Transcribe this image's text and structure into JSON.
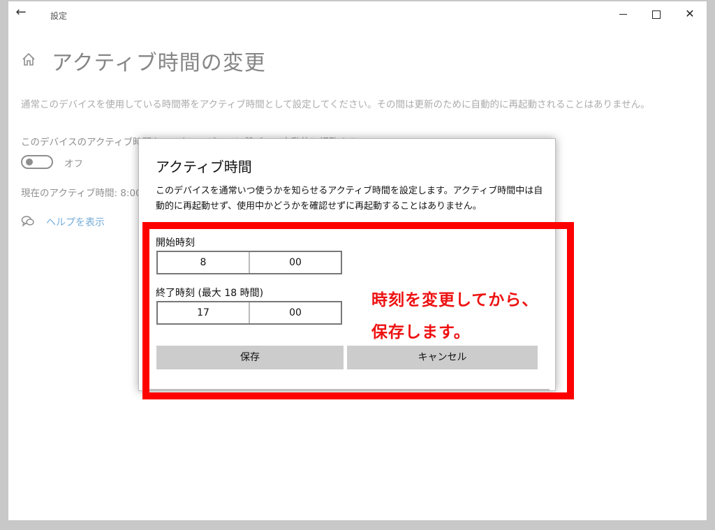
{
  "window": {
    "title": "設定",
    "back_icon": "back-arrow-icon",
    "controls": {
      "minimize": "minimize-icon",
      "maximize": "maximize-icon",
      "close": "close-icon",
      "close_glyph": "✕"
    }
  },
  "page": {
    "title": "アクティブ時間の変更",
    "description": "通常このデバイスを使用している時間帯をアクティブ時間として設定してください。その間は更新のために自動的に再起動されることはありません。",
    "adjust_label": "このデバイスのアクティブ時間を、アクティビティに基づいて自動的に調整する",
    "toggle_state": "オフ",
    "current_label": "現在のアクティブ時間: 8:00 か",
    "help_link": "ヘルプを表示"
  },
  "dialog": {
    "title": "アクティブ時間",
    "description": "このデバイスを通常いつ使うかを知らせるアクティブ時間を設定します。アクティブ時間中は自動的に再起動せず、使用中かどうかを確認せずに再起動することはありません。",
    "start": {
      "label": "開始時刻",
      "hour": "8",
      "minute": "00"
    },
    "end": {
      "label": "終了時刻 (最大 18 時間)",
      "hour": "17",
      "minute": "00"
    },
    "save_label": "保存",
    "cancel_label": "キャンセル"
  },
  "annotation": {
    "line1": "時刻を変更してから、",
    "line2": "保存します。",
    "color": "#ff0000"
  }
}
